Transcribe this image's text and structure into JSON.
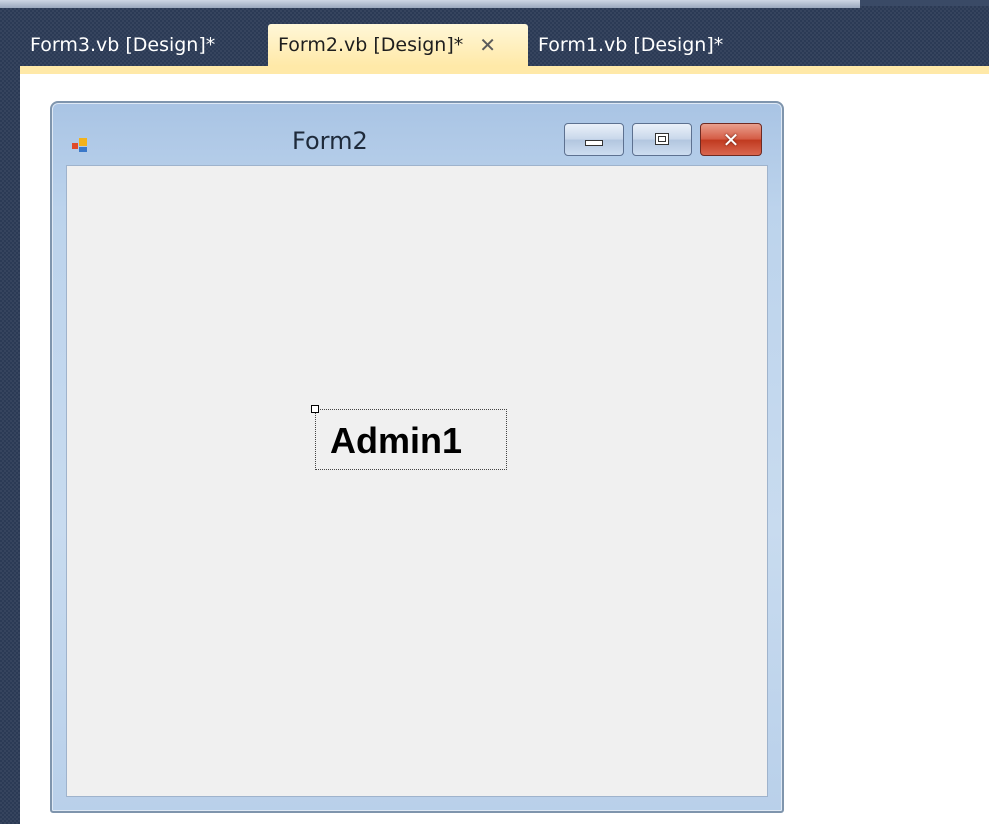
{
  "tabs": [
    {
      "label": "Form3.vb [Design]*",
      "active": false
    },
    {
      "label": "Form2.vb [Design]*",
      "active": true,
      "close_icon": "close-icon"
    },
    {
      "label": "Form1.vb [Design]*",
      "active": false
    }
  ],
  "form": {
    "title": "Form2",
    "icon": "form-icon",
    "buttons": {
      "minimize": "minimize-icon",
      "maximize": "maximize-icon",
      "close": "close-icon"
    },
    "label": {
      "text": "Admin1",
      "selected": true
    }
  },
  "colors": {
    "active_tab": "#ffe9a8",
    "ide_background": "#2b3a55",
    "designer_surface": "#ffffff",
    "form_client": "#f0f0f0",
    "close_button": "#c0391f"
  }
}
